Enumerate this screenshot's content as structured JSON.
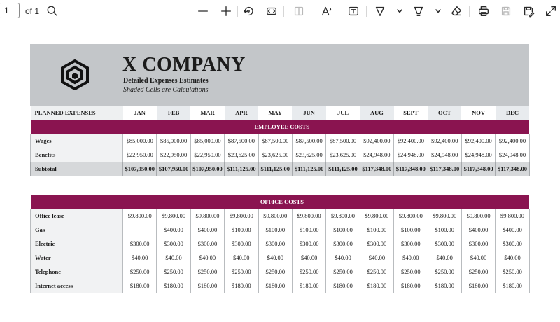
{
  "toolbar": {
    "page_number": "1",
    "page_of": "of 1",
    "icons": [
      "search-icon",
      "zoom-out-icon",
      "zoom-in-icon",
      "rotate-icon",
      "fit-page-icon",
      "page-view-icon",
      "read-aloud-icon",
      "text-box-icon",
      "draw-icon",
      "highlight-icon",
      "erase-icon",
      "print-icon",
      "save-icon",
      "save-as-icon",
      "fullscreen-icon"
    ]
  },
  "document": {
    "company": "X COMPANY",
    "subtitle": "Detailed Expenses Estimates",
    "note": "Shaded Cells are Calculations",
    "planned_label": "PLANNED EXPENSES",
    "months": [
      "JAN",
      "FEB",
      "MAR",
      "APR",
      "MAY",
      "JUN",
      "JUL",
      "AUG",
      "SEPT",
      "OCT",
      "NOV",
      "DEC"
    ],
    "employee_section": {
      "title": "EMPLOYEE COSTS",
      "rows": [
        {
          "label": "Wages",
          "values": [
            "$85,000.00",
            "$85,000.00",
            "$85,000.00",
            "$87,500.00",
            "$87,500.00",
            "$87,500.00",
            "$87,500.00",
            "$92,400.00",
            "$92,400.00",
            "$92,400.00",
            "$92,400.00",
            "$92,400.00"
          ]
        },
        {
          "label": "Benefits",
          "values": [
            "$22,950.00",
            "$22,950.00",
            "$22,950.00",
            "$23,625.00",
            "$23,625.00",
            "$23,625.00",
            "$23,625.00",
            "$24,948.00",
            "$24,948.00",
            "$24,948.00",
            "$24,948.00",
            "$24,948.00"
          ]
        }
      ],
      "subtotal": {
        "label": "Subtotal",
        "values": [
          "$107,950.00",
          "$107,950.00",
          "$107,950.00",
          "$111,125.00",
          "$111,125.00",
          "$111,125.00",
          "$111,125.00",
          "$117,348.00",
          "$117,348.00",
          "$117,348.00",
          "$117,348.00",
          "$117,348.00"
        ]
      }
    },
    "office_section": {
      "title": "OFFICE COSTS",
      "rows": [
        {
          "label": "Office lease",
          "values": [
            "$9,800.00",
            "$9,800.00",
            "$9,800.00",
            "$9,800.00",
            "$9,800.00",
            "$9,800.00",
            "$9,800.00",
            "$9,800.00",
            "$9,800.00",
            "$9,800.00",
            "$9,800.00",
            "$9,800.00"
          ]
        },
        {
          "label": "Gas",
          "values": [
            "",
            "$400.00",
            "$400.00",
            "$100.00",
            "$100.00",
            "$100.00",
            "$100.00",
            "$100.00",
            "$100.00",
            "$100.00",
            "$400.00",
            "$400.00"
          ]
        },
        {
          "label": "Electric",
          "values": [
            "$300.00",
            "$300.00",
            "$300.00",
            "$300.00",
            "$300.00",
            "$300.00",
            "$300.00",
            "$300.00",
            "$300.00",
            "$300.00",
            "$300.00",
            "$300.00"
          ]
        },
        {
          "label": "Water",
          "values": [
            "$40.00",
            "$40.00",
            "$40.00",
            "$40.00",
            "$40.00",
            "$40.00",
            "$40.00",
            "$40.00",
            "$40.00",
            "$40.00",
            "$40.00",
            "$40.00"
          ]
        },
        {
          "label": "Telephone",
          "values": [
            "$250.00",
            "$250.00",
            "$250.00",
            "$250.00",
            "$250.00",
            "$250.00",
            "$250.00",
            "$250.00",
            "$250.00",
            "$250.00",
            "$250.00",
            "$250.00"
          ]
        },
        {
          "label": "Internet access",
          "values": [
            "$180.00",
            "$180.00",
            "$180.00",
            "$180.00",
            "$180.00",
            "$180.00",
            "$180.00",
            "$180.00",
            "$180.00",
            "$180.00",
            "$180.00",
            "$180.00"
          ]
        }
      ]
    },
    "colors": {
      "section_bar": "#8a1450",
      "header_band": "#c3c6c9",
      "subtotal_fill": "#d6d8da"
    }
  }
}
